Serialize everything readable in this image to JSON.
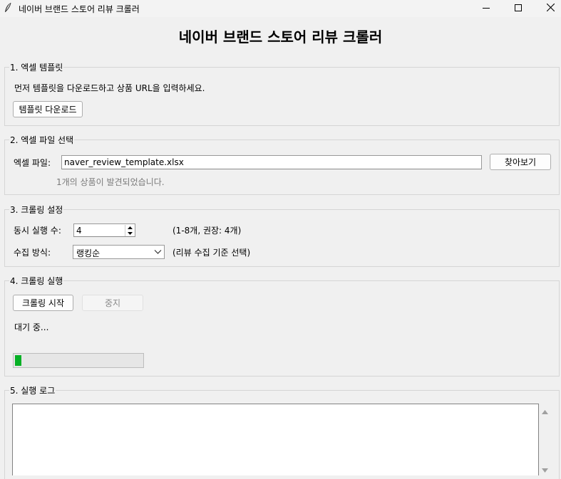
{
  "window": {
    "title": "네이버 브랜드 스토어 리뷰 크롤러",
    "app_icon": "feather-icon",
    "controls": [
      "minimize-icon",
      "maximize-icon",
      "close-icon"
    ]
  },
  "header": {
    "title": "네이버 브랜드 스토어 리뷰 크롤러"
  },
  "section1": {
    "legend": "1. 엑셀 템플릿",
    "description": "먼저 템플릿을 다운로드하고 상품 URL을 입력하세요.",
    "download_button": "템플릿 다운로드"
  },
  "section2": {
    "legend": "2. 엑셀 파일 선택",
    "file_label": "엑셀 파일:",
    "file_value": "naver_review_template.xlsx",
    "browse_button": "찾아보기",
    "status": "1개의 상품이 발견되었습니다."
  },
  "section3": {
    "legend": "3. 크롤링 설정",
    "concurrency_label": "동시 실행 수:",
    "concurrency_value": "4",
    "concurrency_hint": "(1-8개, 권장: 4개)",
    "method_label": "수집 방식:",
    "method_value": "랭킹순",
    "method_hint": "(리뷰 수집 기준 선택)"
  },
  "section4": {
    "legend": "4. 크롤링 실행",
    "start_button": "크롤링 시작",
    "stop_button": "중지",
    "status": "대기 중...",
    "progress": 0.05,
    "progress_color": "#06b025"
  },
  "section5": {
    "legend": "5. 실행 로그",
    "log_text": ""
  }
}
